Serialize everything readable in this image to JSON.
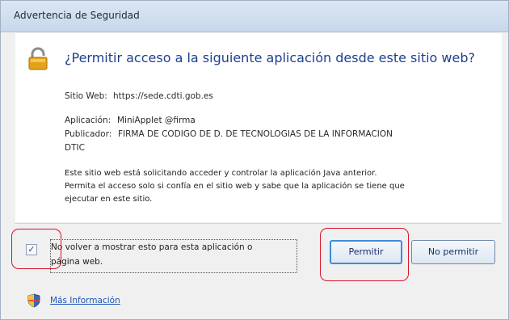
{
  "window": {
    "title": "Advertencia de Seguridad"
  },
  "dialog": {
    "heading": "¿Permitir acceso a la siguiente aplicación desde este sitio web?",
    "site_label": "Sitio Web:",
    "site_value": "https://sede.cdti.gob.es",
    "app_label": "Aplicación:",
    "app_value": "MiniApplet @firma",
    "publisher_label": "Publicador:",
    "publisher_value_line1": "FIRMA DE CODIGO DE D. DE TECNOLOGIAS DE LA INFORMACION",
    "publisher_value_line2": "DTIC",
    "warning_line1": "Este sitio web está solicitando acceder y controlar la aplicación Java anterior.",
    "warning_line2": "Permita el acceso solo si confía en el sitio web y sabe que la aplicación se tiene que",
    "warning_line3": "ejecutar en este sitio."
  },
  "options": {
    "checkbox_checked": true,
    "checkbox_mark": "✓",
    "checkbox_label_line1": "No volver a mostrar esto para esta aplicación o",
    "checkbox_label_line2": "página web."
  },
  "buttons": {
    "allow": "Permitir",
    "deny": "No permitir"
  },
  "footer": {
    "more_info": "Más Información"
  },
  "colors": {
    "heading": "#1f3f8f",
    "annotation": "#d9142a",
    "link": "#1f56b8"
  },
  "icons": {
    "lock": "lock-icon",
    "shield": "shield-icon"
  }
}
